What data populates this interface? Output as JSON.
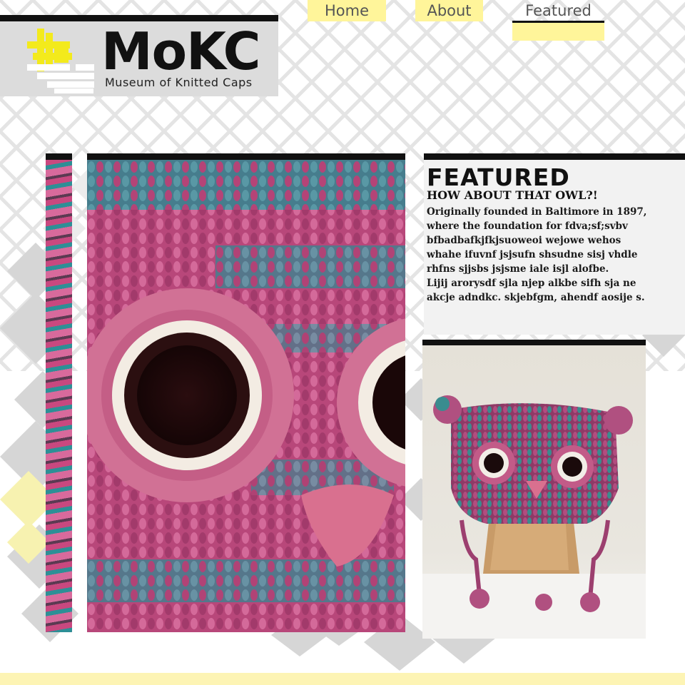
{
  "nav": {
    "home": "Home",
    "about": "About",
    "featured": "Featured",
    "active": "Featured"
  },
  "logo": {
    "name": "MoKC",
    "tagline": "Museum of Knitted Caps"
  },
  "featured": {
    "heading": "FEATURED",
    "subheading": "HOW ABOUT THAT OWL?!",
    "paragraph1": "Originally founded in Baltimore in 1897, where the foundation for fdva;sf;svbv bfbadbafkjfkjsuoweoi wejowe wehos whahe ifuvnf jsjsufn shsudne sisj vhdle rhfns sjjsbs jsjsme iale isjl alofbe.",
    "paragraph2": "Lijij arorysdf sjla njep alkbe sifh sja ne akcje adndkc. skjebfgm, ahendf aosije s."
  },
  "colors": {
    "accent_yellow": "#fff59a",
    "logo_yellow": "#f3ea1c",
    "bar_black": "#111111",
    "header_grey": "#dcdcdc",
    "footer_yellow": "#fdf4b4"
  },
  "icons": {
    "logo": "knitted-blocks-logo-icon"
  }
}
